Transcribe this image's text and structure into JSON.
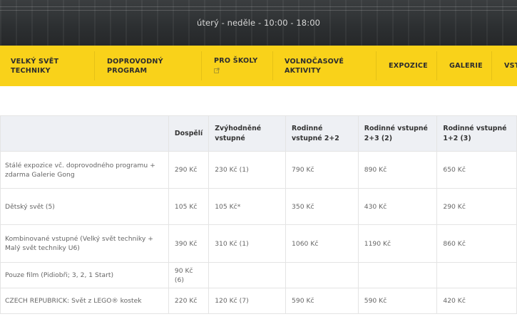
{
  "hero": {
    "hours": "úterý - neděle - 10:00 - 18:00"
  },
  "nav": {
    "items": [
      {
        "line1": "VELKÝ SVĚT",
        "line2": "TECHNIKY"
      },
      {
        "line1": "DOPROVODNÝ",
        "line2": "PROGRAM"
      },
      {
        "line1": "PRO ŠKOLY",
        "line2": "",
        "external": true
      },
      {
        "line1": "VOLNOČASOVÉ",
        "line2": "AKTIVITY"
      },
      {
        "line1": "EXPOZICE",
        "line2": ""
      },
      {
        "line1": "GALERIE",
        "line2": ""
      },
      {
        "line1": "VST",
        "line2": ""
      }
    ]
  },
  "table": {
    "headers": [
      "",
      "Dospělí",
      "Zvýhodněné vstupné",
      "Rodinné vstupné 2+2",
      "Rodinné vstupné 2+3 (2)",
      "Rodinné vstupné 1+2 (3)"
    ],
    "rows": [
      {
        "label": "Stálé expozice vč. doprovodného programu + zdarma Galerie Gong",
        "cells": [
          "290 Kč",
          "230 Kč (1)",
          "790 Kč",
          "890 Kč",
          "650 Kč"
        ]
      },
      {
        "label": "Dětský svět (5)",
        "cells": [
          "105 Kč",
          "105 Kč*",
          "350 Kč",
          "430 Kč",
          "290 Kč"
        ]
      },
      {
        "label": "Kombinované vstupné (Velký svět techniky + Malý svět techniky U6)",
        "cells": [
          "390 Kč",
          "310 Kč (1)",
          "1060 Kč",
          "1190 Kč",
          "860 Kč"
        ]
      },
      {
        "label": "Pouze film (Pidiobři; 3, 2, 1 Start)",
        "cells": [
          "90 Kč (6)",
          "",
          "",
          "",
          ""
        ]
      },
      {
        "label": "CZECH REPUBRICK: Svět z LEGO® kostek",
        "cells": [
          "220 Kč",
          "120 Kč (7)",
          "590 Kč",
          "590 Kč",
          "420 Kč"
        ]
      }
    ]
  },
  "colors": {
    "nav_bg": "#f9d21a",
    "header_bg": "#eef0f4",
    "hero_bg": "#2c2f31"
  },
  "icons": {
    "external_link": "external-link-icon"
  }
}
